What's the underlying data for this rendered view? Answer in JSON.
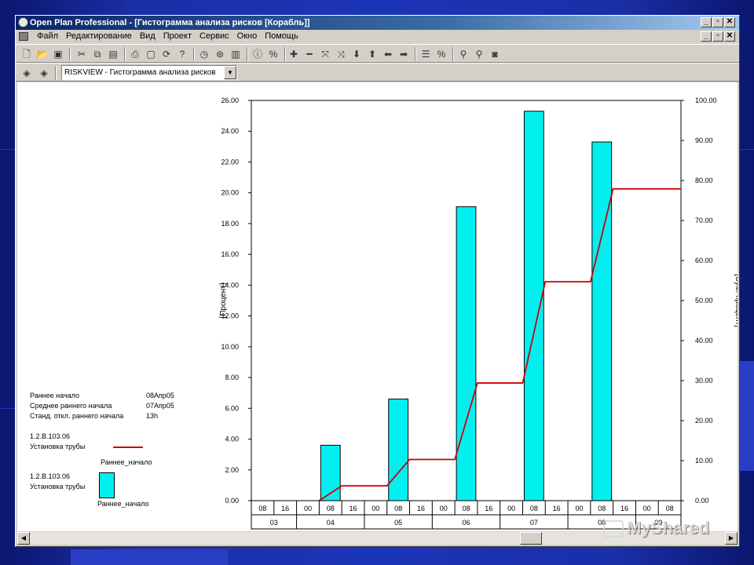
{
  "window": {
    "title": "Open Plan Professional - [Гистограмма анализа рисков [Корабль]]",
    "title_buttons": [
      "_",
      "▫",
      "✕"
    ],
    "child_buttons": [
      "_",
      "▫",
      "✕"
    ]
  },
  "menu": {
    "items": [
      "Файл",
      "Редактирование",
      "Вид",
      "Проект",
      "Сервис",
      "Окно",
      "Помощь"
    ]
  },
  "toolbar": {
    "view_selector": "RISKVIEW - Гистограмма анализа рисков",
    "icons": [
      "new-icon",
      "open-icon",
      "save-icon",
      "cut-icon",
      "copy-icon",
      "paste-icon",
      "print-icon",
      "preview-icon",
      "refresh-icon",
      "help-icon",
      "clock-icon",
      "calc-icon",
      "chart-icon",
      "info-icon",
      "percent-icon",
      "plus-icon",
      "minus-icon",
      "link-icon",
      "unlink-icon",
      "arrow-down-icon",
      "arrow-up-icon",
      "arrow-left-icon",
      "arrow-right-icon",
      "outline-icon",
      "percent2-icon",
      "zoom-in-icon",
      "zoom-out-icon",
      "camera-icon"
    ]
  },
  "legend": {
    "early_start_label": "Раннее начало",
    "early_start_value": "08Апр05",
    "mean_early_label": "Среднее раннего начала",
    "mean_early_value": "07Апр05",
    "std_label": "Станд. откл. раннего начала",
    "std_value": "13h",
    "line_item_id": "1.2.B.103.06",
    "line_item_name": "Установка трубы",
    "line_series": "Раннее_начало",
    "bar_item_id": "1.2.B.103.06",
    "bar_item_name": "Установка трубы",
    "bar_series": "Раннее_начало"
  },
  "watermark": "MyShared",
  "chart_data": {
    "type": "bar",
    "ylabel": "[Процент]",
    "y2label": "[Сум. процент]",
    "ylim": [
      0,
      26
    ],
    "y2lim": [
      0,
      100
    ],
    "yticks": [
      "0.00",
      "2.00",
      "4.00",
      "6.00",
      "8.00",
      "10.00",
      "12.00",
      "14.00",
      "16.00",
      "18.00",
      "20.00",
      "22.00",
      "24.00",
      "26.00"
    ],
    "y2ticks": [
      "0.00",
      "10.00",
      "20.00",
      "30.00",
      "40.00",
      "50.00",
      "60.00",
      "70.00",
      "80.00",
      "90.00",
      "100.00"
    ],
    "x_hours": [
      "08",
      "16",
      "00",
      "08",
      "16",
      "00",
      "08",
      "16",
      "00",
      "08",
      "16",
      "00",
      "08",
      "16",
      "00",
      "08",
      "16",
      "00",
      "08"
    ],
    "x_days": [
      "03",
      "04",
      "05",
      "06",
      "07",
      "08",
      "09"
    ],
    "bars": [
      {
        "slot": 3,
        "value": 3.6
      },
      {
        "slot": 6,
        "value": 6.6
      },
      {
        "slot": 9,
        "value": 19.1
      },
      {
        "slot": 12,
        "value": 25.3
      },
      {
        "slot": 15,
        "value": 23.3
      }
    ],
    "bar_color": "#00f0f0",
    "line_color": "#cc0000",
    "cumulative": [
      {
        "slot": 3,
        "value": 0
      },
      {
        "slot": 4,
        "value": 3.7
      },
      {
        "slot": 6,
        "value": 3.7
      },
      {
        "slot": 7,
        "value": 10.3
      },
      {
        "slot": 9,
        "value": 10.3
      },
      {
        "slot": 10,
        "value": 29.4
      },
      {
        "slot": 12,
        "value": 29.4
      },
      {
        "slot": 13,
        "value": 54.7
      },
      {
        "slot": 15,
        "value": 54.7
      },
      {
        "slot": 16,
        "value": 77.9
      },
      {
        "slot": 19,
        "value": 77.9
      }
    ]
  }
}
